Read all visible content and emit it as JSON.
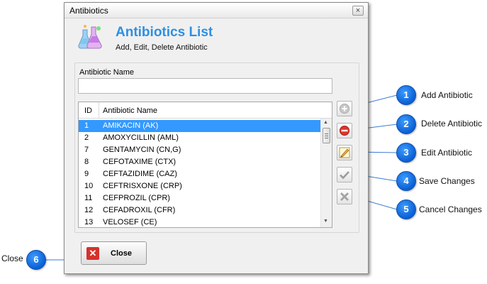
{
  "window": {
    "title": "Antibiotics",
    "close_glyph": "×"
  },
  "header": {
    "icon": "flasks-icon",
    "title": "Antibiotics List",
    "subtitle": "Add, Edit, Delete Antibiotic"
  },
  "form": {
    "name_label": "Antibiotic Name",
    "name_value": ""
  },
  "list": {
    "columns": [
      "ID",
      "Antibiotic Name"
    ],
    "rows": [
      {
        "id": "1",
        "name": "AMIKACIN (AK)",
        "selected": true
      },
      {
        "id": "2",
        "name": "AMOXYCILLIN (AML)"
      },
      {
        "id": "7",
        "name": "GENTAMYCIN (CN,G)"
      },
      {
        "id": "8",
        "name": "CEFOTAXIME (CTX)"
      },
      {
        "id": "9",
        "name": "CEFTAZIDIME (CAZ)"
      },
      {
        "id": "10",
        "name": "CEFTRISXONE (CRP)"
      },
      {
        "id": "11",
        "name": "CEFPROZIL (CPR)"
      },
      {
        "id": "12",
        "name": "CEFADROXIL (CFR)"
      },
      {
        "id": "13",
        "name": "VELOSEF (CE)"
      }
    ]
  },
  "side_buttons": [
    {
      "icon": "add-icon"
    },
    {
      "icon": "delete-icon"
    },
    {
      "icon": "edit-icon"
    },
    {
      "icon": "save-check-icon"
    },
    {
      "icon": "cancel-x-icon"
    }
  ],
  "close_button": {
    "label": "Close",
    "icon": "close-x-icon"
  },
  "callouts": [
    {
      "number": "1",
      "label": "Add Antibiotic"
    },
    {
      "number": "2",
      "label": "Delete Antibiotic"
    },
    {
      "number": "3",
      "label": "Edit Antibiotic"
    },
    {
      "number": "4",
      "label": "Save Changes"
    },
    {
      "number": "5",
      "label": "Cancel Changes"
    },
    {
      "number": "6",
      "label": "Close"
    }
  ],
  "colors": {
    "title_blue": "#2d8fe3",
    "selection": "#3399ff",
    "badge": "#0a5fd4"
  }
}
